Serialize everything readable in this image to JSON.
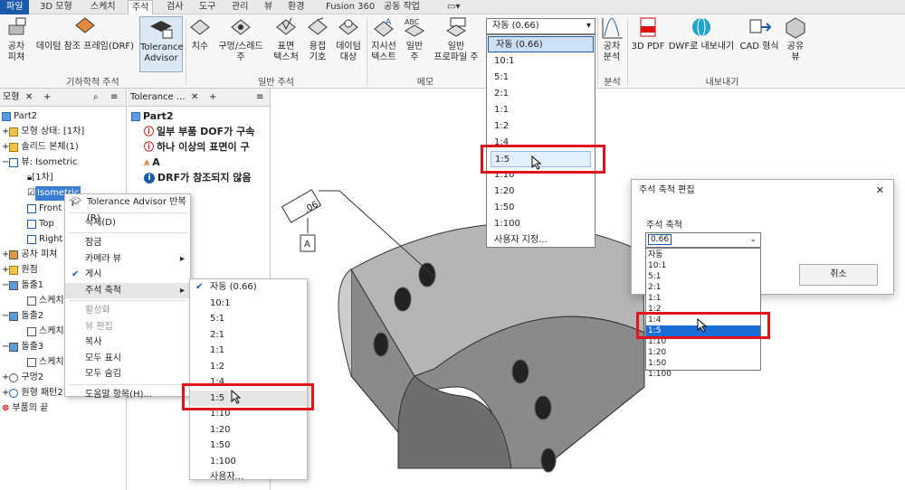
{
  "tabs": [
    "파일",
    "3D 모형",
    "스케치",
    "주석",
    "검사",
    "도구",
    "관리",
    "뷰",
    "환경",
    "Fusion 360",
    "공동 작업"
  ],
  "ribbon": {
    "items": [
      "공차\n피쳐",
      "데이텀 참조 프레임(DRF)",
      "Tolerance\nAdvisor",
      "치수",
      "구멍/스레드\n주",
      "표면\n텍스처",
      "용접\n기호",
      "데이텀\n대상",
      "지시선\n텍스트",
      "일반\n주",
      "일반\n프로파일 주",
      "공차\n분석",
      "3D PDF",
      "DWF로 내보내기",
      "CAD 형식",
      "공유\n뷰"
    ],
    "groups": [
      "기하학적 주석",
      "일반 주석",
      "메모",
      "분석",
      "내보내기"
    ],
    "scale_combo": "자동 (0.66)"
  },
  "browser1": {
    "title": "모형",
    "items": [
      "Part2",
      "모형 상태: [1차]",
      "솔리드 본체(1)",
      "뷰: Isometric",
      "[1차]",
      "Isometric",
      "Front",
      "Top",
      "Right",
      "공차 피쳐",
      "원점",
      "돌출1",
      "스케치",
      "돌출2",
      "스케치",
      "돌출3",
      "스케치",
      "구멍2",
      "원형 패턴2",
      "부품의 끝"
    ]
  },
  "browser2": {
    "title": "Tolerance ...",
    "items": [
      "Part2",
      "일부 부품 DOF가 구속",
      "하나 이상의 표면이 구",
      "A",
      "DRF가 참조되지 않음"
    ]
  },
  "context_menu": {
    "items": [
      "Tolerance Advisor 반복(R)",
      "삭제(D)",
      "잠금",
      "카메라 뷰",
      "게시",
      "주석 축척",
      "활성화",
      "뷰 편집",
      "복사",
      "모두 표시",
      "모두 숨김",
      "도움말 항목(H)..."
    ]
  },
  "submenu": {
    "items": [
      "자동 (0.66)",
      "10:1",
      "5:1",
      "2:1",
      "1:1",
      "1:2",
      "1:4",
      "1:5",
      "1:10",
      "1:20",
      "1:50",
      "1:100",
      "사용자..."
    ]
  },
  "ribbon_dropdown": {
    "items": [
      "자동 (0.66)",
      "10:1",
      "5:1",
      "2:1",
      "1:1",
      "1:2",
      "1:4",
      "1:5",
      "1:10",
      "1:20",
      "1:50",
      "1:100",
      "사용자 지정..."
    ]
  },
  "dialog": {
    "title": "주석 축척 편집",
    "label": "주석 축척",
    "combo_value": "0.66",
    "list": [
      "자동",
      "10:1",
      "5:1",
      "2:1",
      "1:1",
      "1:2",
      "1:4",
      "1:5",
      "1:10",
      "1:20",
      "1:50",
      "1:100"
    ],
    "cancel": "취소"
  },
  "annotation": {
    "value": ".06",
    "datum": "A"
  }
}
